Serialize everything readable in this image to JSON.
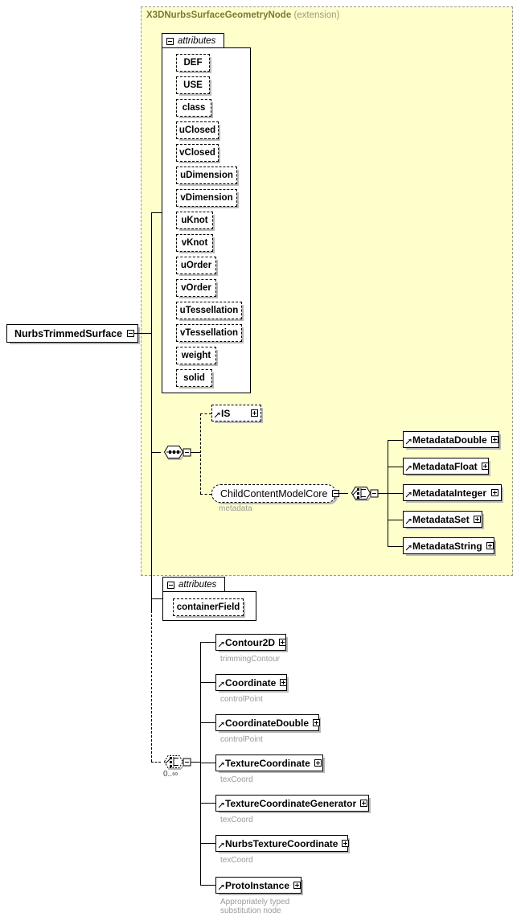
{
  "diagram": {
    "root": {
      "label": "NurbsTrimmedSurface",
      "toggle": "minus"
    },
    "extension_panel": {
      "title": "X3DNurbsSurfaceGeometryNode",
      "kind": "(extension)",
      "background": "#ffffcc",
      "border_color": "#9a9a9a"
    },
    "attributes_group_1": {
      "label": "attributes",
      "toggle": "minus",
      "items": [
        {
          "name": "DEF"
        },
        {
          "name": "USE"
        },
        {
          "name": "class"
        },
        {
          "name": "uClosed"
        },
        {
          "name": "vClosed"
        },
        {
          "name": "uDimension"
        },
        {
          "name": "vDimension"
        },
        {
          "name": "uKnot"
        },
        {
          "name": "vKnot"
        },
        {
          "name": "uOrder"
        },
        {
          "name": "vOrder"
        },
        {
          "name": "uTessellation"
        },
        {
          "name": "vTessellation"
        },
        {
          "name": "weight"
        },
        {
          "name": "solid"
        }
      ]
    },
    "sequence_connector": {
      "type": "sequence"
    },
    "is_element": {
      "label": "IS",
      "toggle": "plus"
    },
    "content_group": {
      "label": "ChildContentModelCore",
      "toggle": "minus",
      "caption": "metadata"
    },
    "choice_connector_metadata": {
      "type": "choice",
      "toggle": "minus"
    },
    "metadata_elements": [
      {
        "label": "MetadataDouble",
        "toggle": "plus"
      },
      {
        "label": "MetadataFloat",
        "toggle": "plus"
      },
      {
        "label": "MetadataInteger",
        "toggle": "plus"
      },
      {
        "label": "MetadataSet",
        "toggle": "plus"
      },
      {
        "label": "MetadataString",
        "toggle": "plus"
      }
    ],
    "attributes_group_2": {
      "label": "attributes",
      "toggle": "minus",
      "items": [
        {
          "name": "containerField"
        }
      ]
    },
    "choice_connector_children": {
      "type": "choice",
      "toggle": "minus",
      "cardinality": "0..∞"
    },
    "child_elements": [
      {
        "label": "Contour2D",
        "toggle": "plus",
        "caption": "trimmingContour"
      },
      {
        "label": "Coordinate",
        "toggle": "plus",
        "caption": "controlPoint"
      },
      {
        "label": "CoordinateDouble",
        "toggle": "plus",
        "caption": "controlPoint"
      },
      {
        "label": "TextureCoordinate",
        "toggle": "plus",
        "caption": "texCoord"
      },
      {
        "label": "TextureCoordinateGenerator",
        "toggle": "plus",
        "caption": "texCoord"
      },
      {
        "label": "NurbsTextureCoordinate",
        "toggle": "plus",
        "caption": "texCoord"
      },
      {
        "label": "ProtoInstance",
        "toggle": "plus",
        "caption": "Appropriately typed\nsubstitution node"
      }
    ]
  }
}
